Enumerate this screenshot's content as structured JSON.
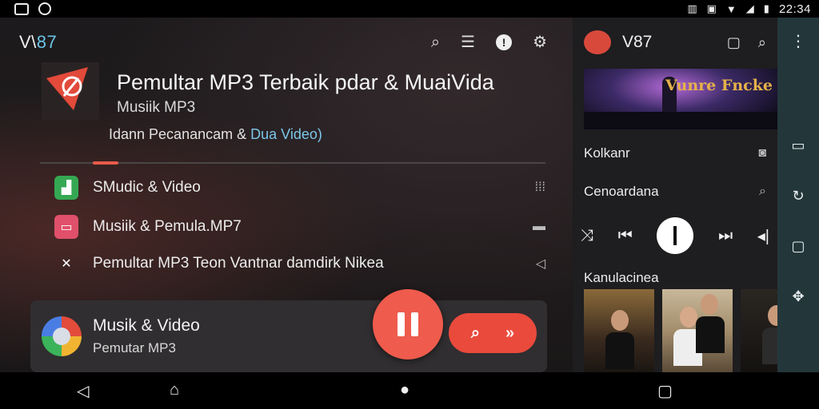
{
  "status_bar": {
    "left_icons": [
      "image-icon",
      "chat-bubble-icon"
    ],
    "right_icons": [
      "vibrate-icon",
      "nfc-icon",
      "wifi-icon",
      "signal-icon",
      "battery-icon"
    ],
    "time": "22:34"
  },
  "header": {
    "brand_prefix": "V\\",
    "brand_accent": "87",
    "icons": [
      "search-icon",
      "list-icon",
      "info-icon",
      "settings-icon"
    ]
  },
  "app": {
    "title": "Pemultar MP3 Terbaik pdar & MuaiVida",
    "subtitle": "Musiik MP3",
    "desc_main": "Idann Pecanancam & ",
    "desc_highlight": "Dua Video)"
  },
  "menu": [
    {
      "label": "SMudic & Video",
      "icon": "music-file-icon",
      "end_icon": "grid-icon",
      "color": "#35a853"
    },
    {
      "label": "Musiik & Pemula.MP7",
      "icon": "bookmark-icon",
      "end_icon": "battery-icon",
      "color": "#e0506a"
    },
    {
      "label": "Pemultar MP3 Teon Vantnar damdirk Nikea",
      "icon": "shuffle-icon",
      "end_icon": "share-icon",
      "color": ""
    }
  ],
  "player": {
    "title": "Musik & Video",
    "subtitle": "Pemutar MP3",
    "accent": "#ef5b4c"
  },
  "right_panel": {
    "brand": "V87",
    "featured_sign": "Vunre Fncke",
    "rows": [
      {
        "label": "Kolkanr",
        "icon": "camera-icon"
      },
      {
        "label": "Cenoardana",
        "icon": "search-icon"
      }
    ],
    "section_title": "Kanulacinea"
  },
  "side_rail": {
    "icons": [
      "more-vert-icon",
      "tablet-icon",
      "rotate-icon",
      "square-icon",
      "puzzle-icon"
    ]
  },
  "nav_bar": {
    "icons": [
      "back-icon",
      "home-up-icon",
      "home-icon",
      "recents-icon"
    ]
  }
}
